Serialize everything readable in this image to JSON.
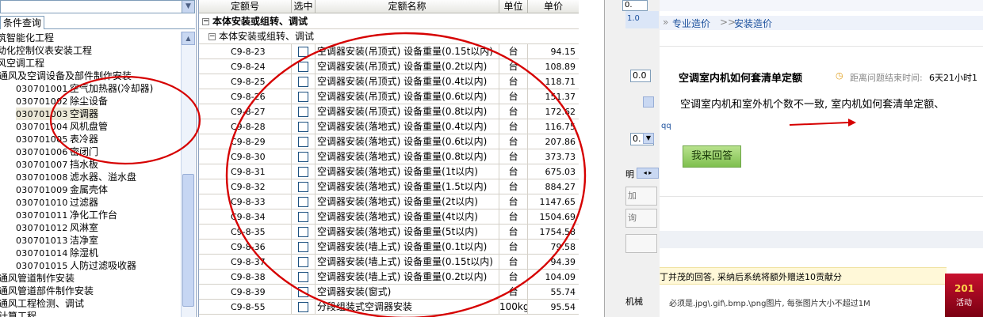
{
  "left_panel": {
    "tab": "条件查询",
    "tree": [
      {
        "code": "",
        "text": "筑智能化工程",
        "indent": 0
      },
      {
        "code": "",
        "text": "动化控制仪表安装工程",
        "indent": 0
      },
      {
        "code": "",
        "text": "风空调工程",
        "indent": 0
      },
      {
        "code": "",
        "text": "通风及空调设备及部件制作安装",
        "indent": 1
      },
      {
        "code": "030701001",
        "text": "空气加热器(冷却器)",
        "indent": 2
      },
      {
        "code": "030701002",
        "text": "除尘设备",
        "indent": 2
      },
      {
        "code": "030701003",
        "text": "空调器",
        "indent": 2,
        "selected": true
      },
      {
        "code": "030701004",
        "text": "风机盘管",
        "indent": 2
      },
      {
        "code": "030701005",
        "text": "表冷器",
        "indent": 2
      },
      {
        "code": "030701006",
        "text": "密闭门",
        "indent": 2
      },
      {
        "code": "030701007",
        "text": "挡水板",
        "indent": 2
      },
      {
        "code": "030701008",
        "text": "滤水器、溢水盘",
        "indent": 2
      },
      {
        "code": "030701009",
        "text": "金属壳体",
        "indent": 2
      },
      {
        "code": "030701010",
        "text": "过滤器",
        "indent": 2
      },
      {
        "code": "030701011",
        "text": "净化工作台",
        "indent": 2
      },
      {
        "code": "030701012",
        "text": "风淋室",
        "indent": 2
      },
      {
        "code": "030701013",
        "text": "洁净室",
        "indent": 2
      },
      {
        "code": "030701014",
        "text": "除湿机",
        "indent": 2
      },
      {
        "code": "030701015",
        "text": "人防过滤吸收器",
        "indent": 2
      },
      {
        "code": "",
        "text": "通风管道制作安装",
        "indent": 1
      },
      {
        "code": "",
        "text": "通风管道部件制作安装",
        "indent": 1
      },
      {
        "code": "",
        "text": "通风工程检测、调试",
        "indent": 1
      },
      {
        "code": "",
        "text": "计算工程",
        "indent": 1
      }
    ]
  },
  "grid": {
    "headers": [
      "定额号",
      "选中",
      "定额名称",
      "单位",
      "单价"
    ],
    "group1": "本体安装或组转、调试",
    "group2": "本体安装或组转、调试",
    "rows": [
      {
        "code": "C9-8-23",
        "name": "空调器安装(吊顶式) 设备重量(0.15t以内)",
        "unit": "台",
        "price": "94.15"
      },
      {
        "code": "C9-8-24",
        "name": "空调器安装(吊顶式) 设备重量(0.2t以内)",
        "unit": "台",
        "price": "108.89"
      },
      {
        "code": "C9-8-25",
        "name": "空调器安装(吊顶式) 设备重量(0.4t以内)",
        "unit": "台",
        "price": "118.71"
      },
      {
        "code": "C9-8-26",
        "name": "空调器安装(吊顶式) 设备重量(0.6t以内)",
        "unit": "台",
        "price": "151.37"
      },
      {
        "code": "C9-8-27",
        "name": "空调器安装(吊顶式) 设备重量(0.8t以内)",
        "unit": "台",
        "price": "172.62"
      },
      {
        "code": "C9-8-28",
        "name": "空调器安装(落地式) 设备重量(0.4t以内)",
        "unit": "台",
        "price": "116.75"
      },
      {
        "code": "C9-8-29",
        "name": "空调器安装(落地式) 设备重量(0.6t以内)",
        "unit": "台",
        "price": "207.86"
      },
      {
        "code": "C9-8-30",
        "name": "空调器安装(落地式) 设备重量(0.8t以内)",
        "unit": "台",
        "price": "373.73"
      },
      {
        "code": "C9-8-31",
        "name": "空调器安装(落地式) 设备重量(1t以内)",
        "unit": "台",
        "price": "675.03"
      },
      {
        "code": "C9-8-32",
        "name": "空调器安装(落地式) 设备重量(1.5t以内)",
        "unit": "台",
        "price": "884.27"
      },
      {
        "code": "C9-8-33",
        "name": "空调器安装(落地式) 设备重量(2t以内)",
        "unit": "台",
        "price": "1147.65"
      },
      {
        "code": "C9-8-34",
        "name": "空调器安装(落地式) 设备重量(4t以内)",
        "unit": "台",
        "price": "1504.69"
      },
      {
        "code": "C9-8-35",
        "name": "空调器安装(落地式) 设备重量(5t以内)",
        "unit": "台",
        "price": "1754.58"
      },
      {
        "code": "C9-8-36",
        "name": "空调器安装(墙上式) 设备重量(0.1t以内)",
        "unit": "台",
        "price": "79.58"
      },
      {
        "code": "C9-8-37",
        "name": "空调器安装(墙上式) 设备重量(0.15t以内)",
        "unit": "台",
        "price": "94.39"
      },
      {
        "code": "C9-8-38",
        "name": "空调器安装(墙上式) 设备重量(0.2t以内)",
        "unit": "台",
        "price": "104.09"
      },
      {
        "code": "C9-8-39",
        "name": "空调器安装(窗式)",
        "unit": "台",
        "price": "55.74"
      },
      {
        "code": "C9-8-55",
        "name": "分段组装式空调器安装",
        "unit": "100kg",
        "price": "95.54"
      }
    ]
  },
  "browser": {
    "breadcrumb": [
      "专业造价",
      "安装造价"
    ],
    "breadcrumb_sep": ">>",
    "question_title": "空调室内机如何套清单定额",
    "countdown_label": "距离问题结束时间:",
    "countdown_value": "6天21小时1",
    "question_body": "空调室内机和室外机个数不一致, 室内机如何套清单定额、",
    "username_frag": "qq",
    "answer_button": "我来回答",
    "reward_note": "丁并茂的回答, 采纳后系统将额外赠送10贡献分",
    "upload_note": "必须是.jpg\\.gif\\.bmp.\\png图片, 每张图片大小不超过1M",
    "side_labels": [
      "0.",
      "1.0",
      "0.0",
      "0.",
      "明",
      "加",
      "询",
      "机械"
    ],
    "ad_text": "201",
    "ad_sub": "活动"
  },
  "colors": {
    "annotation_red": "#d60000",
    "accent_green": "#7fc04f",
    "link_blue": "#1a4f9c"
  }
}
